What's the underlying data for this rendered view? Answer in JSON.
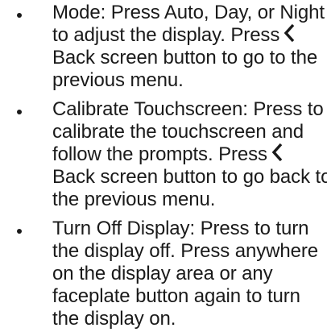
{
  "items": [
    {
      "lines": [
        "Mode: Press Auto, Day, or Night",
        "to adjust the display. Press",
        "Back screen button to go to the",
        "previous menu."
      ],
      "inline_icon_after_line": 1,
      "inline_icon": "back-chevron-icon"
    },
    {
      "lines": [
        "Calibrate Touchscreen: Press to",
        "calibrate the touchscreen and",
        "follow the prompts. Press",
        "Back screen button to go back to",
        "the previous menu."
      ],
      "inline_icon_after_line": 2,
      "inline_icon": "back-chevron-icon"
    },
    {
      "lines": [
        "Turn Off Display: Press to turn",
        "the display off. Press anywhere",
        "on the display area or any",
        "faceplate button again to turn",
        "the display on."
      ]
    }
  ]
}
